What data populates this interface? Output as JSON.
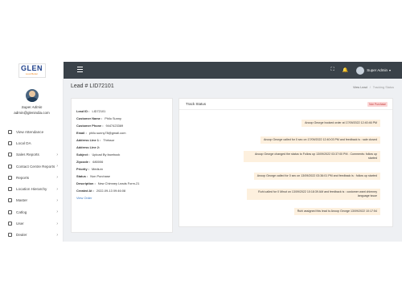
{
  "brand": {
    "logo_text": "GLEN",
    "logo_sub": "Look Better"
  },
  "profile": {
    "name": "Super Admin",
    "email": "admin@glenindia.com"
  },
  "sidebar": {
    "items": [
      {
        "label": "View Attendance",
        "icon": "calendar-icon",
        "chevron": false
      },
      {
        "label": "Local DA",
        "icon": "document-icon",
        "chevron": false
      },
      {
        "label": "Sales Reports",
        "icon": "chart-icon",
        "chevron": true
      },
      {
        "label": "Contact Centre Reports",
        "icon": "phone-icon",
        "chevron": true
      },
      {
        "label": "Reports",
        "icon": "report-icon",
        "chevron": true
      },
      {
        "label": "Location Hierarchy",
        "icon": "location-icon",
        "chevron": true
      },
      {
        "label": "Master",
        "icon": "grid-icon",
        "chevron": true
      },
      {
        "label": "Catlog",
        "icon": "catalog-icon",
        "chevron": true
      },
      {
        "label": "User",
        "icon": "user-icon",
        "chevron": true
      },
      {
        "label": "Dealer",
        "icon": "store-icon",
        "chevron": true
      }
    ]
  },
  "topbar": {
    "user_name": "Super Admin",
    "icons": [
      "fullscreen-icon",
      "bell-icon"
    ]
  },
  "page": {
    "title": "Lead # LID72101",
    "breadcrumb": [
      "View Lead",
      "Tracking Status"
    ]
  },
  "lead": {
    "fields": [
      {
        "label": "Lead ID :",
        "value": "LID72101"
      },
      {
        "label": "Customer Name :",
        "value": "Philo Sunny"
      },
      {
        "label": "Customer Phone :",
        "value": "9447423369"
      },
      {
        "label": "Email :",
        "value": "philo.sunny78@gmail.com"
      },
      {
        "label": "Address Line 1 :",
        "value": "Thrissur"
      },
      {
        "label": "Address Line 2:",
        "value": ""
      },
      {
        "label": "Subject :",
        "value": "Upload By facebook"
      },
      {
        "label": "Zipcode :",
        "value": "680006"
      },
      {
        "label": "Priority :",
        "value": "Medium"
      },
      {
        "label": "Status :",
        "value": "Non Purchase"
      },
      {
        "label": "Description :",
        "value": "New Chimney Leads Form-21"
      },
      {
        "label": "Created At :",
        "value": "2022-09-13 09:46:08"
      }
    ],
    "view_order": "View Order"
  },
  "track": {
    "title": "Track Status",
    "badge": "Non Purchase",
    "messages": [
      "Anoop George booked order at 17/09/2022 12:40:46 PM",
      "Anoop George called for 0 sec on 17/09/2022 12:40:03 PM and feedback is : sale closed",
      "Anoop George changed the status to Follow up 13/09/2022 03:37:00 PM . Comments: follow up started",
      "Anoop George called for 0 sec on 13/09/2022 03:36:01 PM and feedback is : follow up started",
      "Ruhi called for 0 Minut on 13/09/2022 10:18:39 AM and feedback is : customer want chimney language issue",
      "Ruhi assigned this lead to Anoop George 13/09/2022 10:17:54"
    ]
  }
}
